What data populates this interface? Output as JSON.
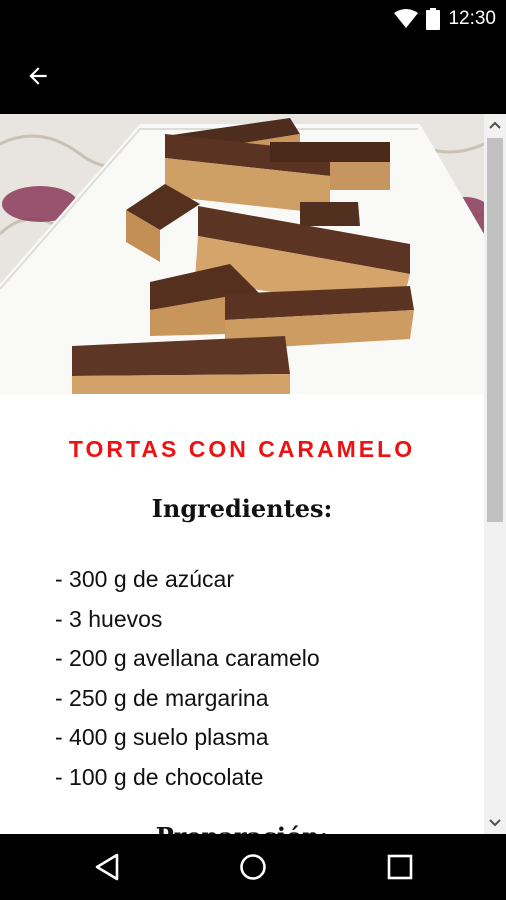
{
  "status_bar": {
    "time": "12:30",
    "icons": [
      "wifi-icon",
      "battery-icon"
    ]
  },
  "app_bar": {
    "back_icon": "arrow-left-icon"
  },
  "recipe": {
    "title": "TORTAS CON CARAMELO",
    "title_color": "#ee1111",
    "ingredients_heading": "Ingredientes:",
    "ingredients": [
      "- 300 g de azúcar",
      "- 3 huevos",
      "- 200 g avellana caramelo",
      "- 250 g de margarina",
      "- 400 g suelo plasma",
      "- 100 g de chocolate"
    ],
    "next_heading_partial": "Preparación:"
  },
  "nav_bar": {
    "icons": [
      "back-triangle-icon",
      "home-circle-icon",
      "recents-square-icon"
    ]
  }
}
